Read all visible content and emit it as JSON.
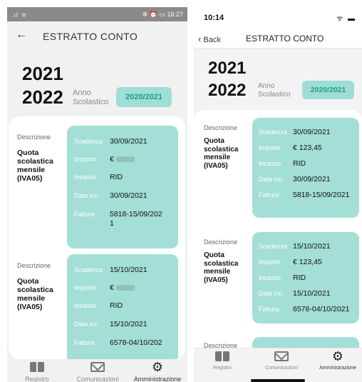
{
  "left": {
    "status": {
      "signal": ".ıl ᯤ",
      "icons": "✲ ⏰ ▭",
      "time": "16:27"
    },
    "header": {
      "title": "ESTRATTO CONTO"
    },
    "year": {
      "line1": "2021",
      "line2": "2022",
      "anno_label_1": "Anno",
      "anno_label_2": "Scolastico",
      "selector": "2020/2021"
    },
    "entries": [
      {
        "desc_label": "Descrizione",
        "desc_lines": [
          "Quota",
          "scolastica",
          "mensile",
          "(IVA05)"
        ],
        "scadenza_k": "Scadenza",
        "scadenza": "30/09/2021",
        "importo_k": "Importo",
        "importo": "€",
        "incasso_k": "Incasso",
        "incasso": "RID",
        "datainc_k": "Data inc.",
        "datainc": "30/09/2021",
        "fattura_k": "Fattura",
        "fattura_1": "5818-15/09/202",
        "fattura_2": "1"
      },
      {
        "desc_label": "Descrizione",
        "desc_lines": [
          "Quota",
          "scolastica",
          "mensile",
          "(IVA05)"
        ],
        "scadenza_k": "Scadenza",
        "scadenza": "15/10/2021",
        "importo_k": "Importo",
        "importo": "€",
        "incasso_k": "Incasso",
        "incasso": "RID",
        "datainc_k": "Data inc.",
        "datainc": "15/10/2021",
        "fattura_k": "Fattura",
        "fattura_1": "6578-04/10/202"
      }
    ],
    "nav": [
      {
        "label": "Registro",
        "icon": "book-icon"
      },
      {
        "label": "Comunicazioni",
        "icon": "mail-icon"
      },
      {
        "label": "Amministrazione",
        "icon": "gear-icon"
      }
    ]
  },
  "right": {
    "status": {
      "time": "10:14",
      "icons": "ᯤ ▬"
    },
    "header": {
      "back": "Back",
      "title": "ESTRATTO CONTO"
    },
    "year": {
      "line1": "2021",
      "line2": "2022",
      "anno_label_1": "Anno",
      "anno_label_2": "Scolastico",
      "selector": "2020/2021"
    },
    "entries": [
      {
        "desc_label": "Descrizione",
        "desc_lines": [
          "Quota",
          "scolastica",
          "mensile",
          "(IVA05)"
        ],
        "scadenza_k": "Scadenza",
        "scadenza": "30/09/2021",
        "importo_k": "Importo",
        "importo": "€ 123,45",
        "incasso_k": "Incasso",
        "incasso": "RID",
        "datainc_k": "Data inc.",
        "datainc": "30/09/2021",
        "fattura_k": "Fattura",
        "fattura": "5818-15/09/2021"
      },
      {
        "desc_label": "Descrizione",
        "desc_lines": [
          "Quota",
          "scolastica",
          "mensile",
          "(IVA05)"
        ],
        "scadenza_k": "Scadenza",
        "scadenza": "15/10/2021",
        "importo_k": "Importo",
        "importo": "€ 123,45",
        "incasso_k": "Incasso",
        "incasso": "RID",
        "datainc_k": "Data inc.",
        "datainc": "15/10/2021",
        "fattura_k": "Fattura",
        "fattura": "6578-04/10/2021"
      },
      {
        "desc_label": "Descrizione"
      }
    ],
    "nav": [
      {
        "label": "Registro",
        "icon": "book-icon"
      },
      {
        "label": "Comunicazioni",
        "icon": "mail-icon"
      },
      {
        "label": "Amministrazione",
        "icon": "gear-icon"
      }
    ]
  },
  "colors": {
    "accent_box": "#a3dfd6",
    "selector_text": "#1f9e8e"
  }
}
